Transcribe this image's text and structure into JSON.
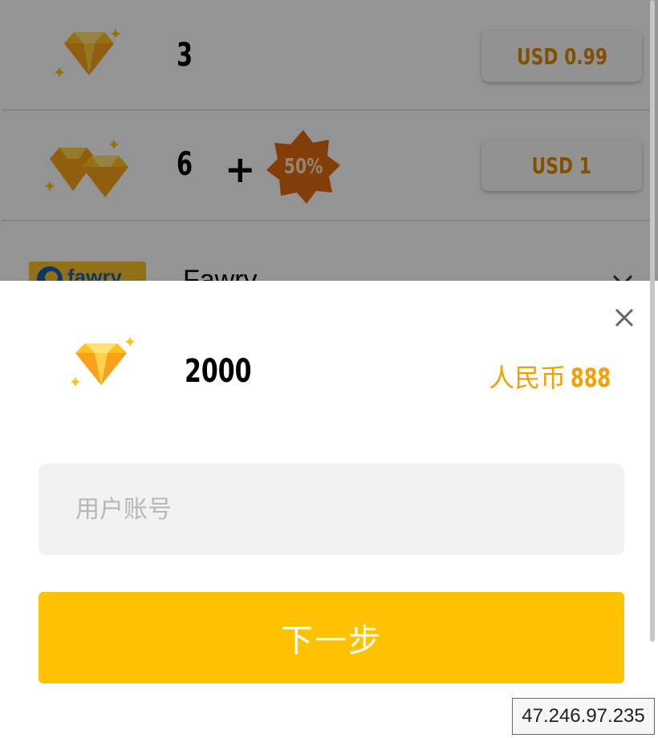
{
  "packages": [
    {
      "quantity": "3",
      "price": "USD 0.99"
    },
    {
      "quantity": "6",
      "plus": "+",
      "bonus": "50%",
      "price": "USD 1"
    }
  ],
  "payment": {
    "logo_text": "fawry",
    "method": "Fawry",
    "chevron": "⌄"
  },
  "dialog": {
    "icon": "diamond-icon",
    "quantity": "2000",
    "currency": "人民币",
    "amount": "888",
    "account_placeholder": "用户账号",
    "next_label": "下一步",
    "close_icon": "close-icon"
  },
  "ip_text": "47.246.97.235",
  "colors": {
    "accent": "#ffc200",
    "price_orange": "#f5a000",
    "badge": "#e06a10"
  }
}
